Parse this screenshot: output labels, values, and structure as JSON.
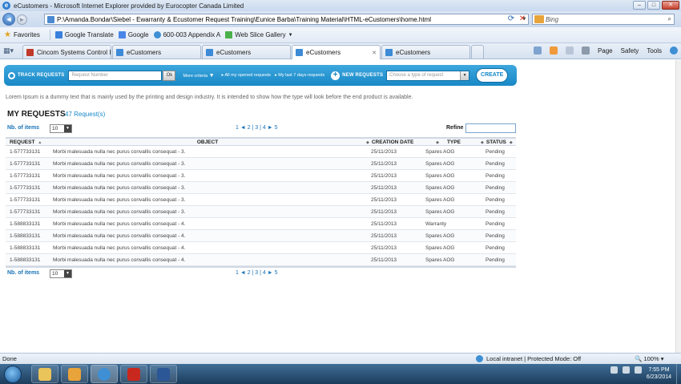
{
  "window": {
    "title": "eCustomers - Microsoft Internet Explorer provided by Eurocopter Canada Limited",
    "address": "P:\\Amanda.Bondar\\Siebel - Ewarranty & Ecustomer Request Training\\Eunice Barba\\Training Material\\HTML-eCustomers\\home.html",
    "search_placeholder": "Bing"
  },
  "favorites": {
    "label": "Favorites",
    "items": [
      "Google Translate",
      "Google",
      "600-003 Appendix A",
      "Web Slice Gallery"
    ]
  },
  "tabs": [
    "Cincom Systems Control I...",
    "eCustomers",
    "eCustomers",
    "eCustomers",
    "eCustomers"
  ],
  "commandbar": {
    "page": "Page",
    "safety": "Safety",
    "tools": "Tools"
  },
  "reqbar": {
    "track_label": "TRACK REQUESTS",
    "request_placeholder": "Request Number",
    "ok": "Ok",
    "more_criteria": "More criteria",
    "opened": "All my opened requests",
    "last7": "My last 7 days requests",
    "new_label": "NEW REQUESTS",
    "type_placeholder": "Choose a type of request",
    "create": "CREATE"
  },
  "lorem": "Lorem Ipsum is a dummy text that is mainly used by the printing and design industry. It is intended to show how the type will look before the end product is available.",
  "myrequests": {
    "title": "MY REQUESTS",
    "count": "47 Request(s)"
  },
  "controls": {
    "nb_items": "Nb. of items",
    "page_size": "10",
    "pager": "1 ◄ 2 | 3 | 4 ► 5",
    "refine": "Refine"
  },
  "columns": [
    "REQUEST",
    "OBJECT",
    "CREATION DATE",
    "TYPE",
    "STATUS"
  ],
  "rows": [
    [
      "1-577733131",
      "Morbi malesuada nulla nec purus convallis consequat - 3.",
      "25/11/2013",
      "Spares AOG",
      "Pending"
    ],
    [
      "1-577733131",
      "Morbi malesuada nulla nec purus convallis consequat - 3.",
      "25/11/2013",
      "Spares AOG",
      "Pending"
    ],
    [
      "1-577733131",
      "Morbi malesuada nulla nec purus convallis consequat - 3.",
      "25/11/2013",
      "Spares AOG",
      "Pending"
    ],
    [
      "1-577733131",
      "Morbi malesuada nulla nec purus convallis consequat - 3.",
      "25/11/2013",
      "Spares AOG",
      "Pending"
    ],
    [
      "1-577733131",
      "Morbi malesuada nulla nec purus convallis consequat - 3.",
      "25/11/2013",
      "Spares AOG",
      "Pending"
    ],
    [
      "1-577733131",
      "Morbi malesuada nulla nec purus convallis consequat - 3.",
      "25/11/2013",
      "Spares AOG",
      "Pending"
    ],
    [
      "1-588833131",
      "Morbi malesuada nulla nec purus convallis consequat - 4.",
      "25/11/2013",
      "Warranty",
      "Pending"
    ],
    [
      "1-588833131",
      "Morbi malesuada nulla nec purus convallis consequat - 4.",
      "25/11/2013",
      "Spares AOG",
      "Pending"
    ],
    [
      "1-588833131",
      "Morbi malesuada nulla nec purus convallis consequat - 4.",
      "25/11/2013",
      "Spares AOG",
      "Pending"
    ],
    [
      "1-588833131",
      "Morbi malesuada nulla nec purus convallis consequat - 4.",
      "25/11/2013",
      "Spares AOG",
      "Pending"
    ]
  ],
  "statusbar": {
    "done": "Done",
    "zone": "Local intranet | Protected Mode: Off",
    "zoom": "100%"
  },
  "clock": {
    "time": "7:55 PM",
    "date": "6/23/2014"
  },
  "colors": {
    "accent": "#1888c6",
    "link": "#1a73b8"
  }
}
